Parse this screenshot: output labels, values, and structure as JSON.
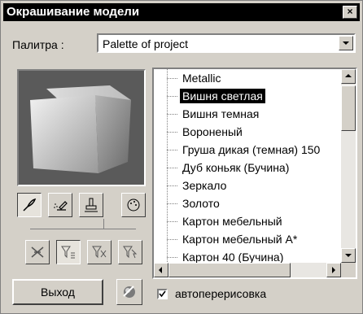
{
  "window": {
    "title": "Окрашивание модели",
    "close_glyph": "×"
  },
  "palette": {
    "label": "Палитра :",
    "selected": "Palette of project"
  },
  "materials": {
    "items": [
      "Metallic",
      "Вишня светлая",
      "Вишня темная",
      "Вороненый",
      "Груша дикая (темная) 150",
      "Дуб коньяк (Бучина)",
      "Зеркало",
      "Золото",
      "Картон мебельный",
      "Картон мебельный А*",
      "Картон 40 (Бучина)"
    ],
    "selected_index": 1
  },
  "tools": {
    "top_row": [
      "brush-icon",
      "spray-icon",
      "stamp-icon",
      "palette-icon"
    ],
    "bottom_row": [
      "filter-all-icon",
      "filter-list-icon",
      "filter-icon",
      "filter-select-icon"
    ]
  },
  "footer": {
    "exit_label": "Выход",
    "auto_redraw_label": "автоперерисовка",
    "auto_redraw_checked": true,
    "small_button_icon": "material-icon"
  }
}
